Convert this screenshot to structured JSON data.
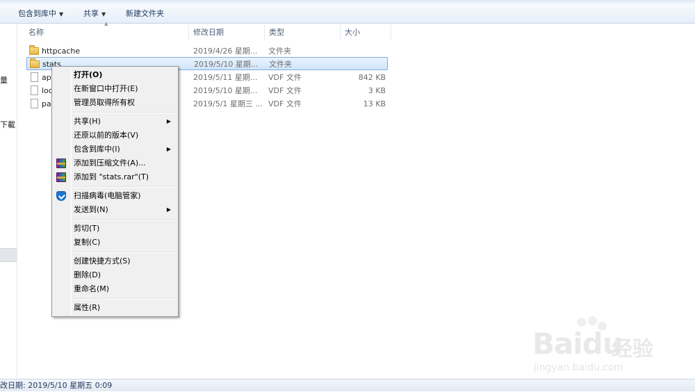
{
  "toolbar": {
    "include_library": "包含到库中",
    "share": "共享",
    "new_folder": "新建文件夹"
  },
  "nav_fragments": [
    "量",
    "下載"
  ],
  "columns": {
    "name": "名称",
    "date": "修改日期",
    "type": "类型",
    "size": "大小"
  },
  "files": [
    {
      "name": "httpcache",
      "date": "2019/4/26 星期...",
      "type": "文件夹",
      "size": "",
      "kind": "folder"
    },
    {
      "name": "stats",
      "date": "2019/5/10 星期...",
      "type": "文件夹",
      "size": "",
      "kind": "folder",
      "selected": true
    },
    {
      "name": "ap",
      "date": "2019/5/11 星期...",
      "type": "VDF 文件",
      "size": "842 KB",
      "kind": "file"
    },
    {
      "name": "loc",
      "date": "2019/5/10 星期...",
      "type": "VDF 文件",
      "size": "3 KB",
      "kind": "file"
    },
    {
      "name": "pa",
      "date": "2019/5/1 星期三 ...",
      "type": "VDF 文件",
      "size": "13 KB",
      "kind": "file"
    }
  ],
  "context_menu": {
    "open": "打开(O)",
    "open_new_window": "在新窗口中打开(E)",
    "take_ownership": "管理员取得所有权",
    "share": "共享(H)",
    "restore_versions": "还原以前的版本(V)",
    "include_library": "包含到库中(I)",
    "add_archive": "添加到压缩文件(A)...",
    "add_to_rar": "添加到 \"stats.rar\"(T)",
    "scan_virus": "扫描病毒(电脑管家)",
    "send_to": "发送到(N)",
    "cut": "剪切(T)",
    "copy": "复制(C)",
    "create_shortcut": "创建快捷方式(S)",
    "delete": "删除(D)",
    "rename": "重命名(M)",
    "properties": "属性(R)"
  },
  "status": {
    "modified": "改日期: 2019/5/10 星期五 0:09"
  },
  "watermark": {
    "logo": "Baidu",
    "cn": "经验",
    "url": "jingyan.baidu.com"
  },
  "colors": {
    "selection": "#cfe5fb",
    "menu_bg": "#f0f0f0",
    "toolbar_text": "#1e395b"
  }
}
